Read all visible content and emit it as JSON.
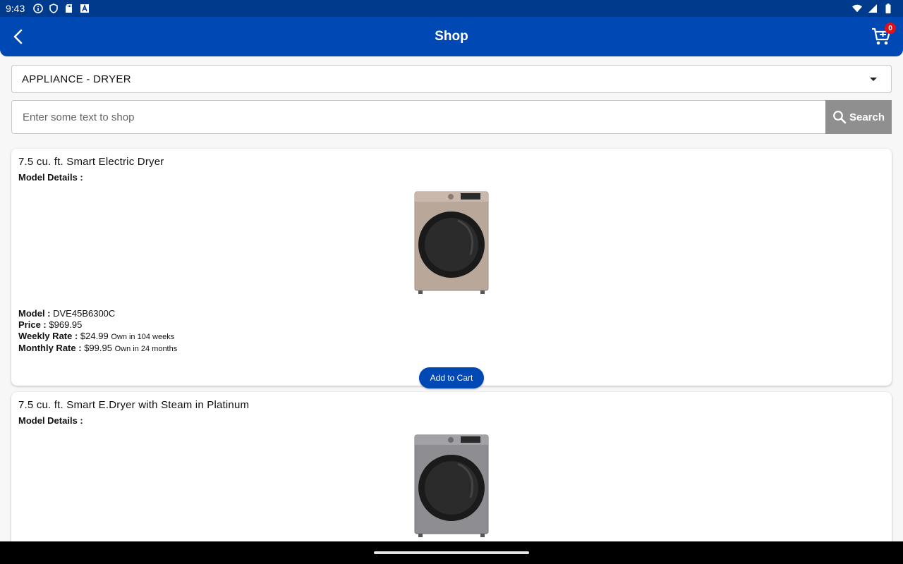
{
  "status_bar": {
    "time": "9:43",
    "icons": [
      "info-icon",
      "shield-icon",
      "sd-card-icon",
      "text-a-icon"
    ],
    "right_icons": [
      "wifi-icon",
      "signal-icon",
      "battery-icon"
    ]
  },
  "app_bar": {
    "title": "Shop",
    "cart_count": "0",
    "accent": "#0048b3"
  },
  "category": {
    "selected": "APPLIANCE - DRYER"
  },
  "search": {
    "placeholder": "Enter some text to shop",
    "value": "",
    "button_label": "Search"
  },
  "products": [
    {
      "title": "7.5 cu. ft. Smart Electric Dryer",
      "details_label": "Model Details :",
      "model_label": "Model :",
      "model": "DVE45B6300C",
      "price_label": "Price :",
      "price": "$969.95",
      "weekly_label": "Weekly Rate :",
      "weekly_rate": "$24.99",
      "weekly_note": "Own in 104 weeks",
      "monthly_label": "Monthly Rate :",
      "monthly_rate": "$99.95",
      "monthly_note": "Own in 24 months",
      "button_label": "Add to Cart",
      "finish_color": "#b9a79a"
    },
    {
      "title": "7.5 cu. ft. Smart E.Dryer with Steam in Platinum",
      "details_label": "Model Details :",
      "finish_color": "#8e8e92"
    }
  ]
}
